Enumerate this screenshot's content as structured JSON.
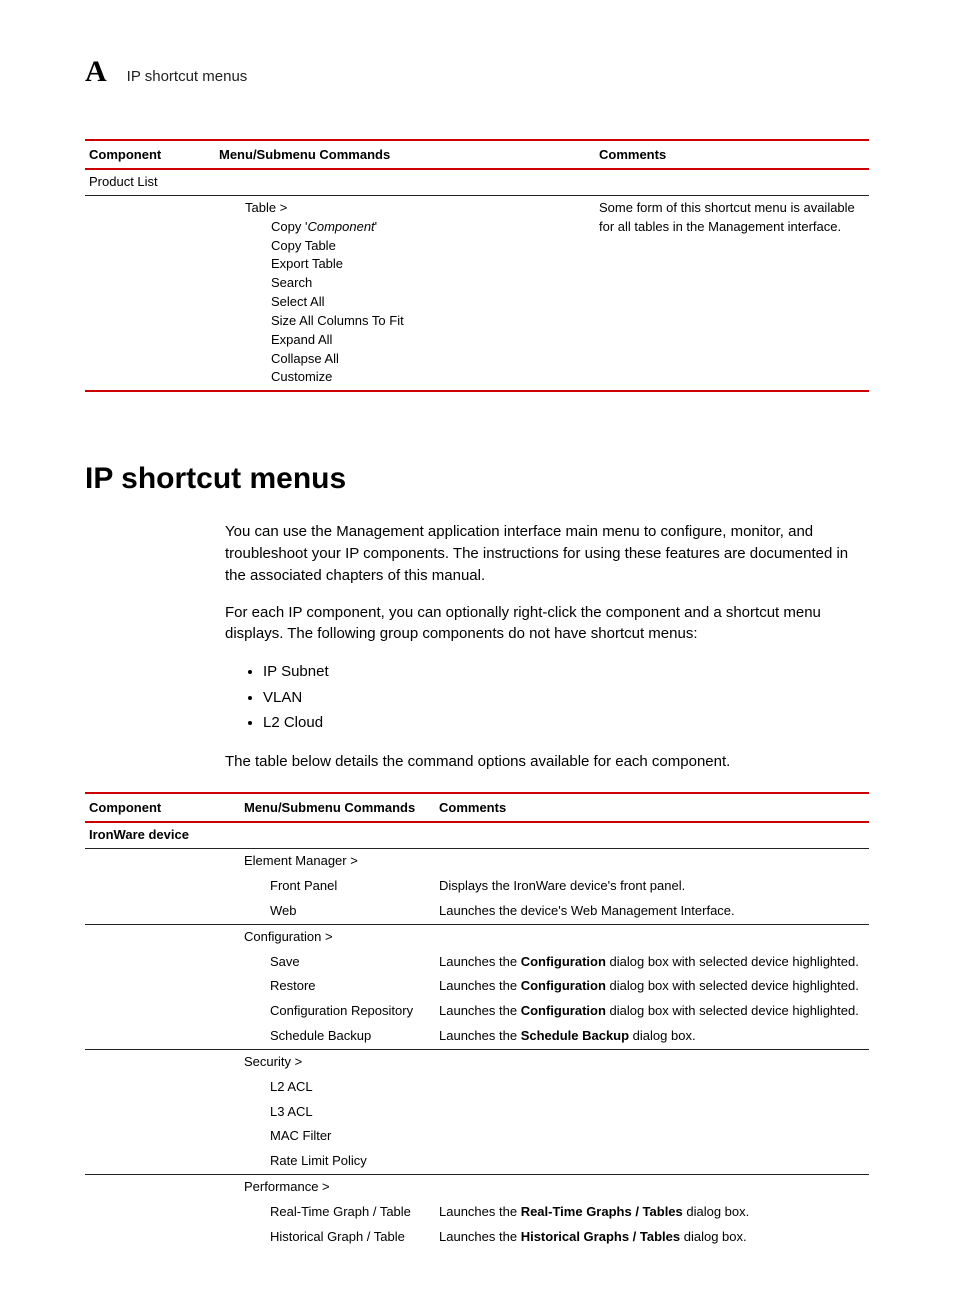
{
  "header": {
    "appendix_letter": "A",
    "title": "IP shortcut menus"
  },
  "table1": {
    "headers": {
      "component": "Component",
      "menu": "Menu/Submenu Commands",
      "comments": "Comments"
    },
    "component_row": "Product List",
    "menu_parent": "Table >",
    "menu_items": [
      "Copy 'Component'",
      "Copy Table",
      "Export Table",
      "Search",
      "Select All",
      "Size All Columns To Fit",
      "Expand All",
      "Collapse All",
      "Customize"
    ],
    "comments_text": "Some form of this shortcut menu is available for all tables in the Management interface."
  },
  "section": {
    "heading": "IP shortcut menus",
    "para1": "You can use the Management application interface main menu to configure, monitor, and troubleshoot your IP components. The instructions for using these features are documented in the associated chapters of this manual.",
    "para2": "For each IP component, you can optionally right-click the component and a shortcut menu displays. The following group components do not have shortcut menus:",
    "bullets": [
      "IP Subnet",
      "VLAN",
      "L2 Cloud"
    ],
    "para3": "The table below details the command options available for each component."
  },
  "table2": {
    "headers": {
      "component": "Component",
      "menu": "Menu/Submenu Commands",
      "comments": "Comments"
    },
    "component_row": "IronWare device",
    "groups": [
      {
        "parent": "Element Manager >",
        "rows": [
          {
            "label": "Front Panel",
            "comment_pre": "Displays the IronWare device's front panel.",
            "comment_bold": "",
            "comment_post": ""
          },
          {
            "label": "Web",
            "comment_pre": "Launches the device's Web Management Interface.",
            "comment_bold": "",
            "comment_post": ""
          }
        ]
      },
      {
        "parent": "Configuration >",
        "rows": [
          {
            "label": "Save",
            "comment_pre": "Launches the ",
            "comment_bold": "Configuration",
            "comment_post": " dialog box with selected device highlighted."
          },
          {
            "label": "Restore",
            "comment_pre": "Launches the ",
            "comment_bold": "Configuration",
            "comment_post": " dialog box with selected device highlighted."
          },
          {
            "label": "Configuration Repository",
            "comment_pre": "Launches the ",
            "comment_bold": "Configuration",
            "comment_post": " dialog box with selected device highlighted."
          },
          {
            "label": "Schedule Backup",
            "comment_pre": "Launches the ",
            "comment_bold": "Schedule Backup",
            "comment_post": " dialog box."
          }
        ]
      },
      {
        "parent": "Security >",
        "rows": [
          {
            "label": "L2 ACL",
            "comment_pre": "",
            "comment_bold": "",
            "comment_post": ""
          },
          {
            "label": "L3 ACL",
            "comment_pre": "",
            "comment_bold": "",
            "comment_post": ""
          },
          {
            "label": "MAC Filter",
            "comment_pre": "",
            "comment_bold": "",
            "comment_post": ""
          },
          {
            "label": "Rate Limit Policy",
            "comment_pre": "",
            "comment_bold": "",
            "comment_post": ""
          }
        ]
      },
      {
        "parent": "Performance >",
        "rows": [
          {
            "label": "Real-Time Graph / Table",
            "comment_pre": "Launches the ",
            "comment_bold": "Real-Time Graphs / Tables",
            "comment_post": " dialog box."
          },
          {
            "label": "Historical Graph / Table",
            "comment_pre": "Launches the ",
            "comment_bold": "Historical Graphs / Tables",
            "comment_post": " dialog box."
          }
        ]
      }
    ]
  }
}
